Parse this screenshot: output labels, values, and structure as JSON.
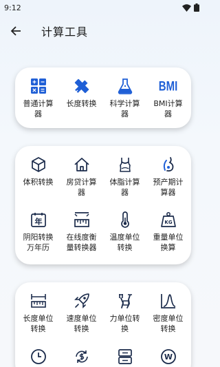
{
  "status_bar": {
    "time": "9:12",
    "icons": [
      "wifi-icon",
      "battery-icon"
    ]
  },
  "app_bar": {
    "title": "计算工具",
    "back_icon": "arrow-left-icon"
  },
  "colors": {
    "accent": "#1f5fd6",
    "text": "#222222"
  },
  "groups": [
    {
      "items": [
        {
          "label": "普通计算器",
          "icon": "calculator-icon"
        },
        {
          "label": "长度转换",
          "icon": "ruler-pencil-icon"
        },
        {
          "label": "科学计算器",
          "icon": "flask-icon"
        },
        {
          "label": "BMI计算器",
          "icon": "bmi-icon",
          "icon_text": "BMI"
        }
      ]
    },
    {
      "items": [
        {
          "label": "体积转换",
          "icon": "cube-icon"
        },
        {
          "label": "房贷计算器",
          "icon": "house-icon"
        },
        {
          "label": "体脂计算器",
          "icon": "swimsuit-icon"
        },
        {
          "label": "预产期计算器",
          "icon": "pregnant-icon"
        },
        {
          "label": "阴阳转换万年历",
          "icon": "calendar-icon",
          "icon_text": "年"
        },
        {
          "label": "在线度衡量转换器",
          "icon": "measure-icon"
        },
        {
          "label": "温度单位转换",
          "icon": "thermometer-icon"
        },
        {
          "label": "重量单位换算",
          "icon": "weight-icon",
          "icon_text": "KG"
        }
      ]
    },
    {
      "items": [
        {
          "label": "长度单位转换",
          "icon": "ruler-icon"
        },
        {
          "label": "速度单位转换",
          "icon": "rocket-icon"
        },
        {
          "label": "力单位转换",
          "icon": "dumbbell-icon"
        },
        {
          "label": "密度单位转换",
          "icon": "bell-curve-icon"
        },
        {
          "label": "",
          "icon": "clock-icon"
        },
        {
          "label": "",
          "icon": "currency-exchange-icon"
        },
        {
          "label": "",
          "icon": "data-storage-icon"
        },
        {
          "label": "",
          "icon": "power-watt-icon",
          "icon_text": "W"
        }
      ]
    }
  ]
}
